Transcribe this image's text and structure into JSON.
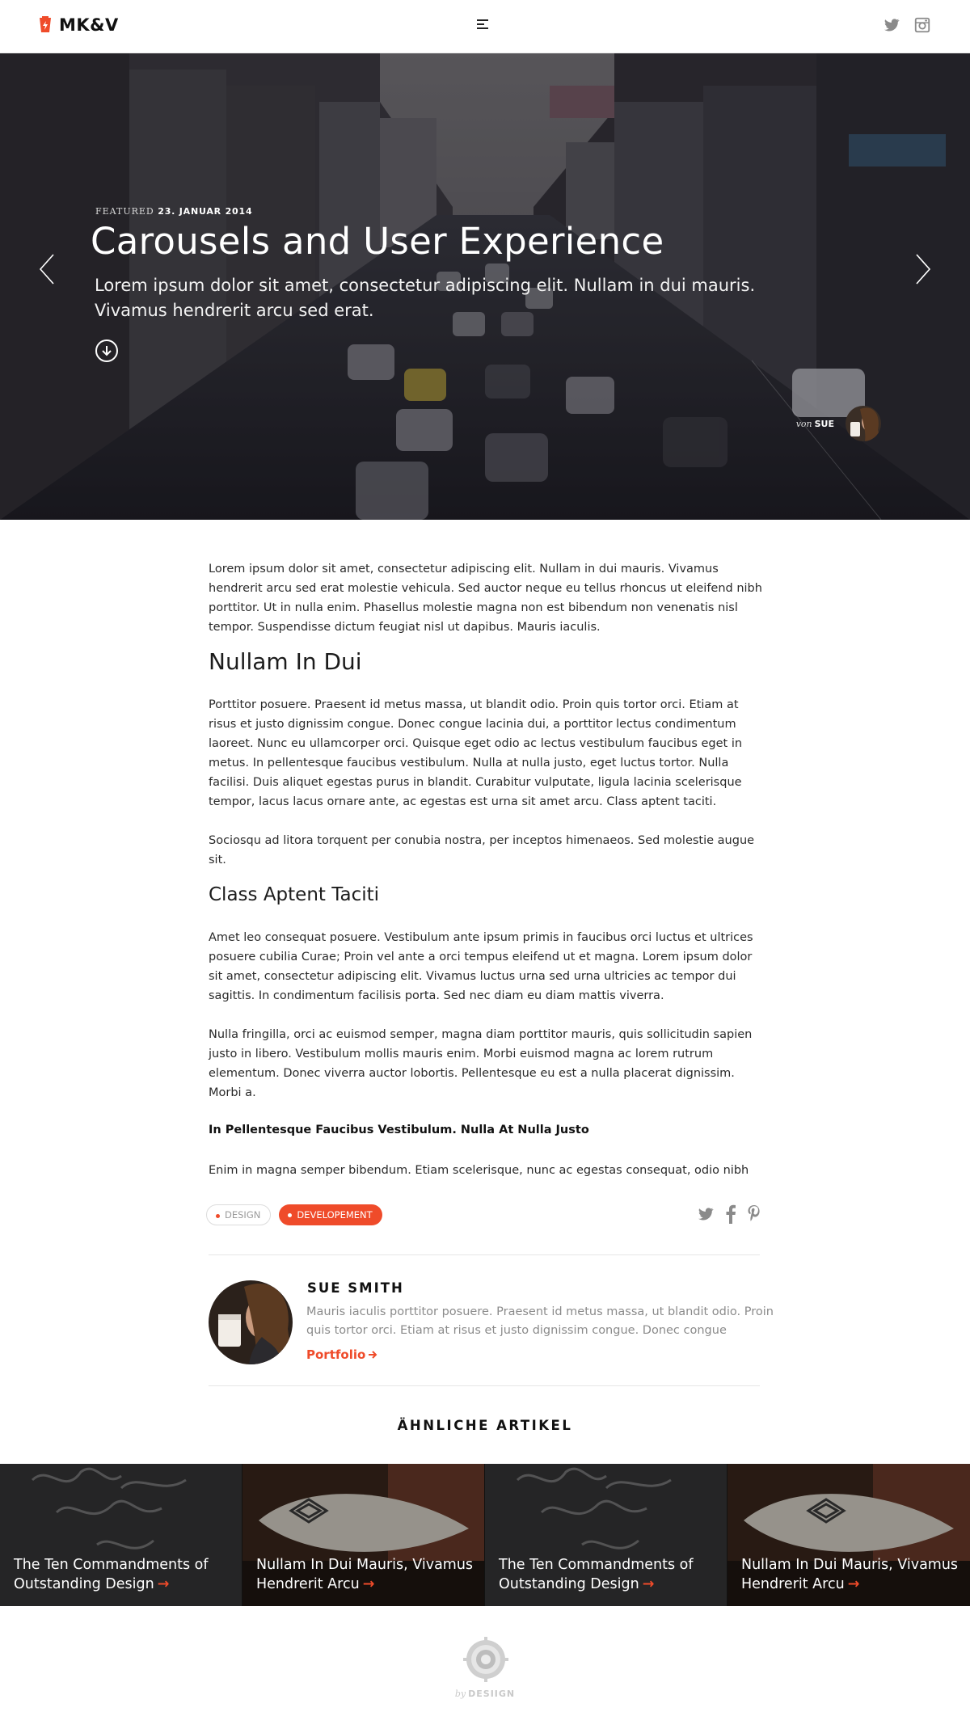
{
  "header": {
    "brand": "MK&V",
    "icons": [
      "twitter-icon",
      "instagram-icon"
    ]
  },
  "hero": {
    "featured_label": "FEATURED",
    "date": "23. JANUAR 2014",
    "title": "Carousels and User Experience",
    "subtitle": "Lorem ipsum dolor sit amet, consectetur adipiscing elit. Nullam in dui mauris. Vivamus hendrerit arcu sed erat.",
    "author_prefix": "von",
    "author": "SUE"
  },
  "article": {
    "intro": "Lorem ipsum dolor sit amet, consectetur adipiscing elit. Nullam in dui mauris. Vivamus hendrerit arcu sed erat molestie vehicula. Sed auctor neque eu tellus rhoncus ut eleifend nibh porttitor. Ut in nulla enim. Phasellus molestie magna non est bibendum non venenatis nisl tempor. Suspendisse dictum feugiat nisl ut dapibus. Mauris iaculis.",
    "heading_1": "Nullam In Dui",
    "para_1": "Porttitor posuere. Praesent id metus massa, ut blandit odio. Proin quis tortor orci. Etiam at risus et justo dignissim congue. Donec congue lacinia dui, a porttitor lectus condimentum laoreet. Nunc eu ullamcorper orci. Quisque eget odio ac lectus vestibulum faucibus eget in metus. In pellentesque faucibus vestibulum. Nulla at nulla justo, eget luctus tortor. Nulla facilisi. Duis aliquet egestas purus in blandit. Curabitur vulputate, ligula lacinia scelerisque tempor, lacus lacus ornare ante, ac egestas est urna sit amet arcu. Class aptent taciti.",
    "para_2": "Sociosqu ad litora torquent per conubia nostra, per inceptos himenaeos. Sed molestie augue sit.",
    "heading_2": "Class Aptent Taciti",
    "para_3": "Amet leo consequat posuere. Vestibulum ante ipsum primis in faucibus orci luctus et ultrices posuere cubilia Curae; Proin vel ante a orci tempus eleifend ut et magna. Lorem ipsum dolor sit amet, consectetur adipiscing elit. Vivamus luctus urna sed urna ultricies ac tempor dui sagittis. In condimentum facilisis porta. Sed nec diam eu diam mattis viverra.",
    "para_4": "Nulla fringilla, orci ac euismod semper, magna diam porttitor mauris, quis sollicitudin sapien justo in libero. Vestibulum mollis mauris enim. Morbi euismod magna ac lorem rutrum elementum. Donec viverra auctor lobortis. Pellentesque eu est a nulla placerat dignissim. Morbi a.",
    "bold_line": "In Pellentesque Faucibus Vestibulum. Nulla At Nulla Justo",
    "para_5": "Enim in magna semper bibendum. Etiam scelerisque, nunc ac egestas consequat, odio nibh"
  },
  "tags": [
    "DESIGN",
    "DEVELOPEMENT"
  ],
  "share_icons": [
    "twitter-icon",
    "facebook-icon",
    "pinterest-icon"
  ],
  "author_box": {
    "name": "SUE SMITH",
    "bio": "Mauris iaculis porttitor posuere. Praesent id metus massa, ut blandit odio. Proin quis tortor orci. Etiam at risus et justo dignissim congue. Donec congue",
    "link": "Portfolio"
  },
  "related": {
    "title": "ÄHNLICHE ARTIKEL",
    "cards": [
      {
        "title": "The Ten Commandments of Outstanding Design"
      },
      {
        "title": "Nullam In Dui Mauris, Vivamus Hendrerit Arcu"
      },
      {
        "title": "The Ten Commandments of Outstanding Design"
      },
      {
        "title": "Nullam In Dui Mauris, Vivamus Hendrerit Arcu"
      }
    ]
  },
  "footer": {
    "by_prefix": "by",
    "brand": "DESIIGN"
  },
  "colors": {
    "accent": "#ef4b2a",
    "text": "#2a2a2a",
    "muted": "#8b8b8b"
  }
}
